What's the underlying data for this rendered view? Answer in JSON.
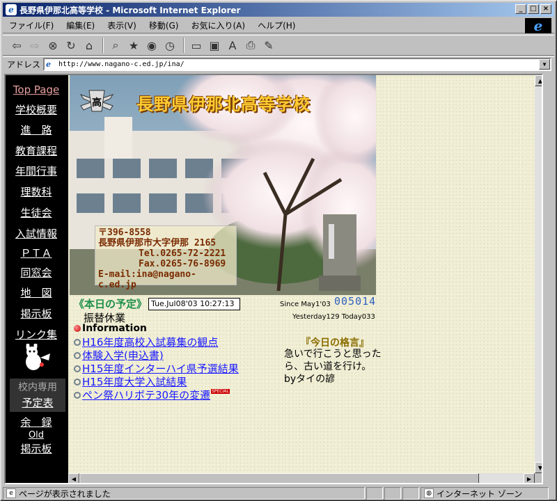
{
  "window": {
    "title": "長野県伊那北高等学校 - Microsoft Internet Explorer",
    "buttons": [
      "_",
      "□",
      "×"
    ]
  },
  "menu": [
    "ファイル(F)",
    "編集(E)",
    "表示(V)",
    "移動(G)",
    "お気に入り(A)",
    "ヘルプ(H)"
  ],
  "address": {
    "label": "アドレス",
    "url": "http://www.nagano-c.ed.jp/ina/"
  },
  "nav": {
    "items": [
      "Top Page",
      "学校概要",
      "進　路",
      "教育課程",
      "年間行事",
      "理数科",
      "生徒会",
      "入試情報",
      "ＰＴＡ",
      "同窓会",
      "地　図",
      "掲示板",
      "リンク集"
    ],
    "restricted_label": "校内専用",
    "restricted_link": "予定表",
    "extra": [
      "余　録",
      "Old",
      "掲示板"
    ]
  },
  "header": {
    "school_name": "長野県伊那北高等学校"
  },
  "contact": {
    "zip": "〒396-8558",
    "address": "長野県伊那市大字伊那 2165",
    "tel": "Tel.0265-72-2221",
    "fax": "Fax.0265-76-8969",
    "email": "E-mail:ina@nagano-c.ed.jp"
  },
  "schedule": {
    "title": "《本日の予定》",
    "date": "Tue.Jul08'03 10:27:13",
    "text": "振替休業"
  },
  "counter": {
    "since": "Since May1'03",
    "value": "005014",
    "yesterday": "Yesterday129 Today033"
  },
  "information": {
    "heading": "Information",
    "links": [
      "H16年度高校入試募集の観点",
      "体験入学(申込書)",
      "H15年度インターハイ県予選結果",
      "H15年度大学入試結果",
      "ペン祭ハリボテ30年の変遷"
    ],
    "badge": "SPECIAL"
  },
  "motto": {
    "title": "『今日の格言』",
    "text": "急いで行こうと思ったら、古い道を行け。byタイの諺"
  },
  "status": {
    "message": "ページが表示されました",
    "zone": "インターネット ゾーン"
  }
}
